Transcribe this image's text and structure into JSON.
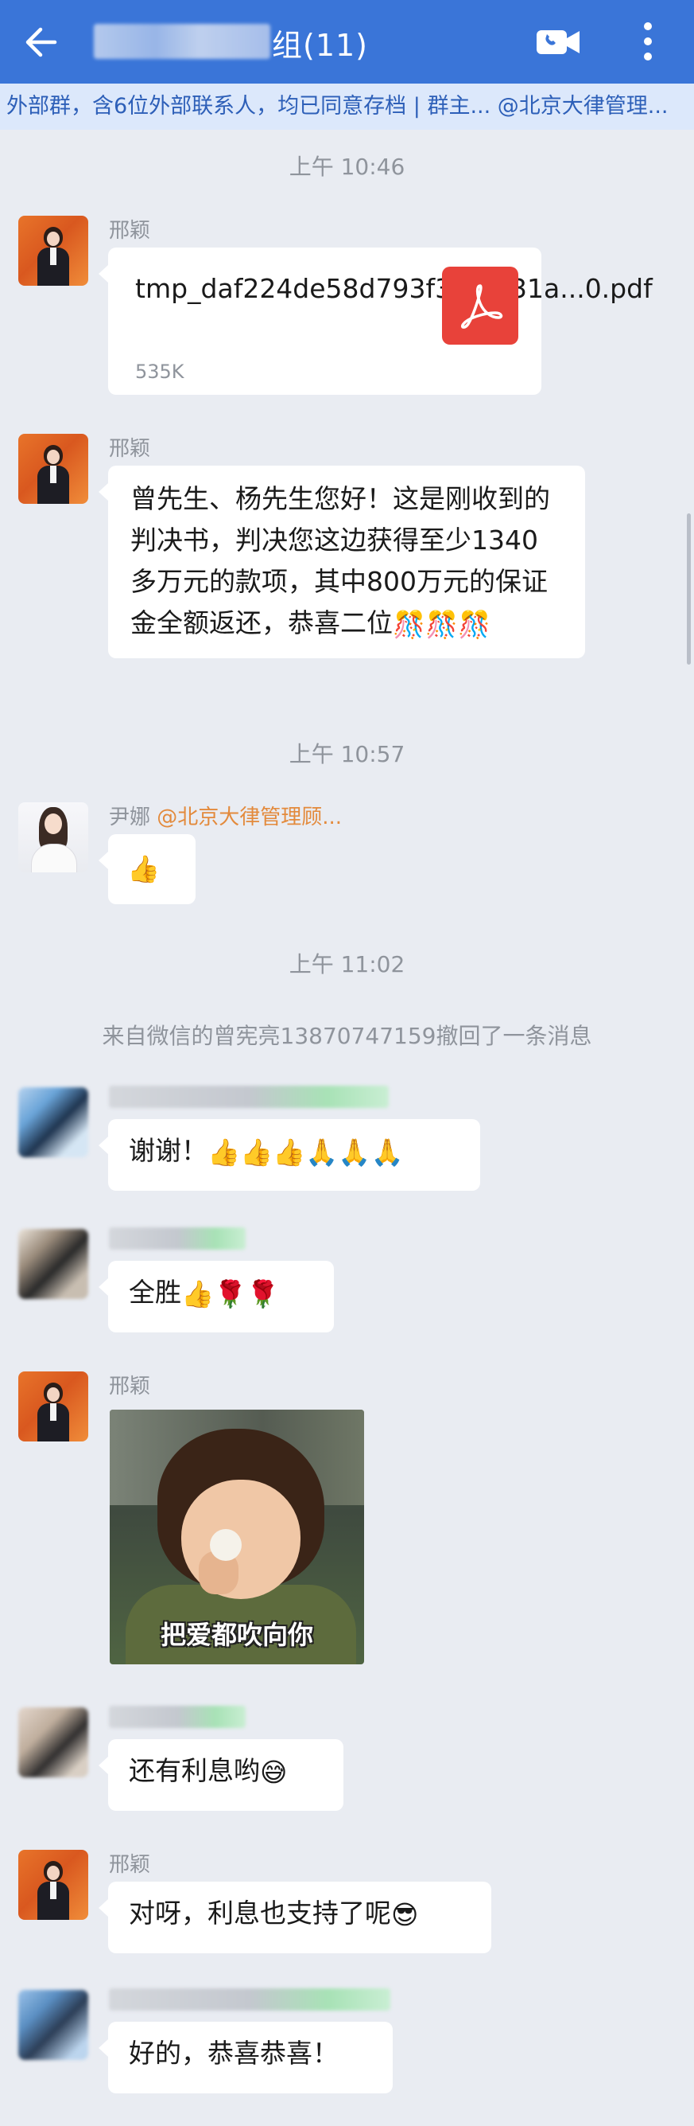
{
  "header": {
    "title_suffix": "组(11)",
    "subtitle": "外部群，含6位外部联系人，均已同意存档 | 群主... @北京大律管理..."
  },
  "messages": [
    {
      "type": "time",
      "text": "上午 10:46"
    },
    {
      "type": "file",
      "sender": "邢颖",
      "file_name": "tmp_daf224de58d793f33fe231a...0.pdf",
      "file_size": "535K",
      "icon": "pdf-icon"
    },
    {
      "type": "text",
      "sender": "邢颖",
      "text": "曾先生、杨先生您好！这是刚收到的判决书，判决您这边获得至少1340多万元的款项，其中800万元的保证金全额返还，恭喜二位",
      "emoji": "🎊🎊🎊"
    },
    {
      "type": "time",
      "text": "上午 10:57"
    },
    {
      "type": "text",
      "sender": "尹娜",
      "mention": "@北京大律管理顾...",
      "emoji": "👍"
    },
    {
      "type": "time",
      "text": "上午 11:02"
    },
    {
      "type": "system",
      "text": "来自微信的曾宪亮13870747159撤回了一条消息"
    },
    {
      "type": "text",
      "sender": "",
      "text": "谢谢！",
      "emoji": "👍👍👍🙏🙏🙏"
    },
    {
      "type": "text",
      "sender": "",
      "text": "全胜",
      "emoji": "👍🌹🌹"
    },
    {
      "type": "image",
      "sender": "邢颖",
      "caption": "把爱都吹向你"
    },
    {
      "type": "text",
      "sender": "",
      "text": "还有利息哟",
      "emoji": "😅"
    },
    {
      "type": "text",
      "sender": "邢颖",
      "text": "对呀，利息也支持了呢",
      "emoji": "😎"
    },
    {
      "type": "text",
      "sender": "",
      "text": "好的，恭喜恭喜！"
    }
  ],
  "colors": {
    "header_bg": "#3a75d8",
    "chat_bg": "#e9ecf2",
    "mention": "#e38a3c",
    "pdf": "#e8423a"
  }
}
